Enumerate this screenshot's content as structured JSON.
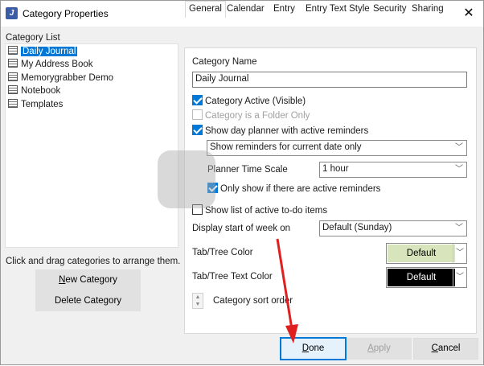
{
  "window": {
    "title": "Category Properties",
    "app_icon": "J"
  },
  "category_list": {
    "label": "Category List",
    "items": [
      {
        "label": "Daily Journal",
        "selected": true
      },
      {
        "label": "My Address Book",
        "selected": false
      },
      {
        "label": "Memorygrabber Demo",
        "selected": false
      },
      {
        "label": "Notebook",
        "selected": false
      },
      {
        "label": "Templates",
        "selected": false
      }
    ],
    "hint": "Click and drag categories to arrange them.",
    "new_button": {
      "mnemonic": "N",
      "rest": "ew Category"
    },
    "delete_button": "Delete Category"
  },
  "tabs": [
    "General",
    "Calendar",
    "Entry",
    "Entry Text Style",
    "Security",
    "Sharing"
  ],
  "general": {
    "category_name_label": "Category Name",
    "category_name_value": "Daily Journal",
    "active_checkbox": {
      "label": "Category Active (Visible)",
      "checked": true
    },
    "folder_checkbox": {
      "label": "Category is a Folder Only",
      "checked": false,
      "disabled": true
    },
    "day_planner_checkbox": {
      "label": "Show day planner with active reminders",
      "checked": true
    },
    "reminders_select": "Show reminders for current date only",
    "planner_time_scale_label": "Planner Time Scale",
    "planner_time_scale_value": "1 hour",
    "only_active_checkbox": {
      "label": "Only show if there are active reminders",
      "checked": true
    },
    "todo_checkbox": {
      "label": "Show list of active to-do items",
      "checked": false
    },
    "week_start_label": "Display start of week on",
    "week_start_value": "Default (Sunday)",
    "tab_color_label": "Tab/Tree Color",
    "tab_color_value": "Default",
    "tab_text_color_label": "Tab/Tree Text Color",
    "tab_text_color_value": "Default",
    "sort_order_label": "Category sort order"
  },
  "buttons": {
    "done": {
      "mnemonic": "D",
      "rest": "one"
    },
    "apply": {
      "mnemonic": "A",
      "rest": "pply"
    },
    "cancel": {
      "mnemonic": "C",
      "rest": "ancel"
    }
  },
  "colors": {
    "accent": "#0078d7",
    "tab_color_swatch": "#d8e4bc",
    "tab_text_color_swatch": "#000000",
    "annotation_arrow": "#e02020"
  },
  "icons": {
    "close": "close-icon",
    "category": "notebook-icon",
    "dropdown": "chevron-down-icon"
  }
}
